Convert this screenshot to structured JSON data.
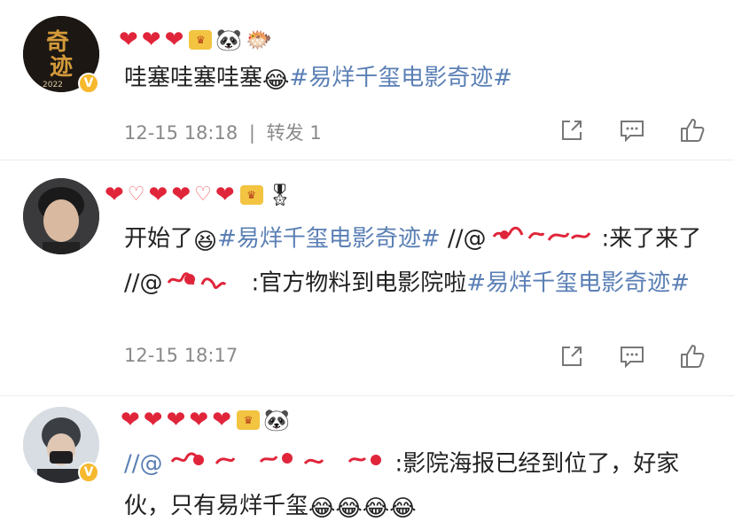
{
  "posts": [
    {
      "avatar_text": [
        "奇",
        "迹"
      ],
      "avatar_sub": "2022",
      "text": "哇塞哇塞哇塞",
      "emoji": "😂",
      "topic": "#易烊千玺电影奇迹#",
      "time": "12-15 18:18",
      "sep": "|",
      "repost": "转发 1",
      "name_emojis": [
        "🐼",
        "🐡"
      ]
    },
    {
      "text1": "开始了",
      "emoji": "😆",
      "topic": "#易烊千玺电影奇迹#",
      "sep1": " //@",
      "redacted1": "",
      "text2": ":来了来了 //@",
      "text3": ":官方物料到电影院啦",
      "topic2": "#易烊千玺电影奇迹#",
      "time": "12-15 18:17",
      "name_emojis": [
        "🎖"
      ]
    },
    {
      "prefix": "//@",
      "text": ":影院海报已经到位了，好家伙，只有易烊千玺",
      "emojis": [
        "😂",
        "😂",
        "😂",
        "😂"
      ],
      "name_emojis": [
        "🐼"
      ]
    }
  ],
  "icons": {
    "share": "share-icon",
    "comment": "comment-icon",
    "like": "thumbs-up-icon",
    "verified": "verified-v-icon"
  },
  "colors": {
    "topic": "#5a7fb5",
    "meta": "#8a8a8a",
    "redact": "#e0253a",
    "verified": "#f6b82d"
  }
}
